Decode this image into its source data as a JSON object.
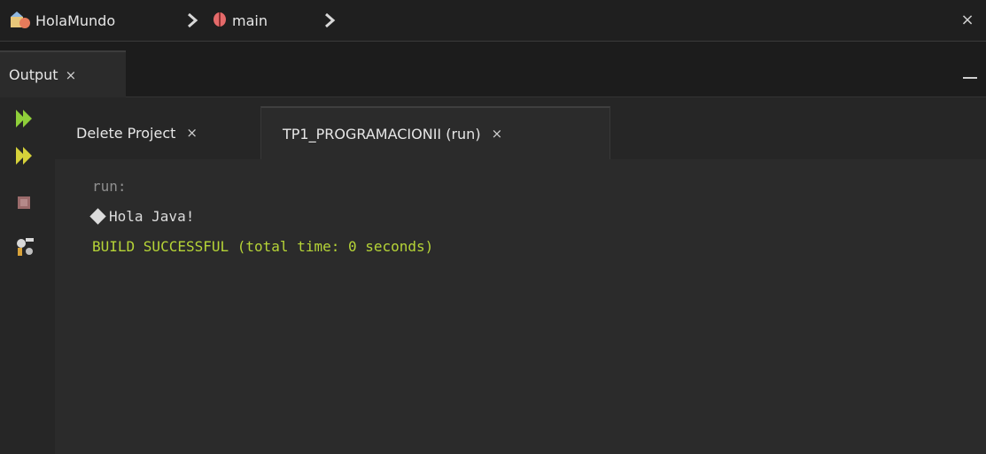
{
  "breadcrumb": {
    "project": "HolaMundo",
    "method": "main",
    "close_label": "×"
  },
  "output_panel": {
    "title": "Output",
    "close_label": "×"
  },
  "subtabs": [
    {
      "label": "Delete Project",
      "close_label": "×",
      "active": false
    },
    {
      "label": "TP1_PROGRAMACIONII (run)",
      "close_label": "×",
      "active": true
    }
  ],
  "console": {
    "lines": [
      {
        "kind": "run",
        "text": "run:"
      },
      {
        "kind": "output",
        "text": "Hola Java!",
        "leading_glyph": "replacement-char-icon"
      },
      {
        "kind": "build",
        "text": "BUILD SUCCESSFUL (total time: 0 seconds)"
      }
    ]
  },
  "toolbar": {
    "icons": [
      "rerun-icon",
      "rerun-fast-icon",
      "stop-icon",
      "settings-icon"
    ]
  },
  "colors": {
    "accent_run": "#b6d437",
    "background": "#2b2b2b",
    "stop": "#9b6b6b"
  }
}
